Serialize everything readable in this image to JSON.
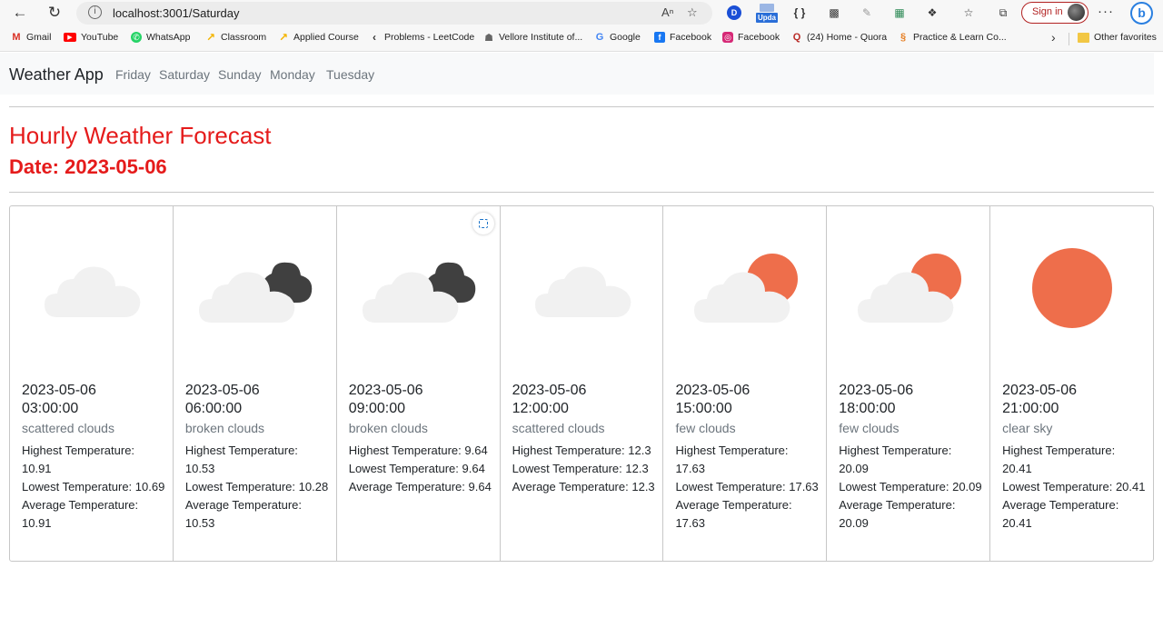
{
  "browser": {
    "url": "localhost:3001/Saturday",
    "ext_update_label": "Upda",
    "signin_label": "Sign in",
    "bookmarks": [
      {
        "label": "Gmail",
        "icon": "gmail-icon",
        "color": "#d93025",
        "glyph": "M"
      },
      {
        "label": "YouTube",
        "icon": "youtube-icon",
        "color": "#ff0000",
        "glyph": "▶"
      },
      {
        "label": "WhatsApp",
        "icon": "whatsapp-icon",
        "color": "#25d366",
        "glyph": "✆"
      },
      {
        "label": "Classroom",
        "icon": "classroom-icon",
        "color": "#f4b400",
        "glyph": "↗"
      },
      {
        "label": "Applied Course",
        "icon": "applied-course-icon",
        "color": "#f4b400",
        "glyph": "↗"
      },
      {
        "label": "Problems - LeetCode",
        "icon": "leetcode-icon",
        "color": "#333333",
        "glyph": "‹"
      },
      {
        "label": "Vellore Institute of...",
        "icon": "vit-icon",
        "color": "#666666",
        "glyph": "☗"
      },
      {
        "label": "Google",
        "icon": "google-icon",
        "color": "#4285f4",
        "glyph": "G"
      },
      {
        "label": "Facebook",
        "icon": "facebook-icon",
        "color": "#1877f2",
        "glyph": "f"
      },
      {
        "label": "Facebook",
        "icon": "instagram-icon",
        "color": "#d62976",
        "glyph": "◎"
      },
      {
        "label": "(24) Home - Quora",
        "icon": "quora-icon",
        "color": "#b92b27",
        "glyph": "Q"
      },
      {
        "label": "Practice & Learn Co...",
        "icon": "gfg-icon",
        "color": "#e67e22",
        "glyph": "§"
      }
    ],
    "other_favorites": "Other favorites"
  },
  "navbar": {
    "brand": "Weather App",
    "links": [
      "Friday",
      "Saturday",
      "Sunday",
      "Monday",
      "Tuesday"
    ]
  },
  "header": {
    "title": "Hourly Weather Forecast",
    "date": "Date: 2023-05-06"
  },
  "forecast": [
    {
      "date": "2023-05-06",
      "time": "03:00:00",
      "desc": "scattered clouds",
      "icon": "scattered-clouds-icon",
      "high_label": "Highest Temperature:",
      "high": "10.91",
      "low_label": "Lowest Temperature:",
      "low": "10.69",
      "avg_label": "Average Temperature:",
      "avg": "10.91"
    },
    {
      "date": "2023-05-06",
      "time": "06:00:00",
      "desc": "broken clouds",
      "icon": "broken-clouds-icon",
      "high_label": "Highest Temperature:",
      "high": "10.53",
      "low_label": "Lowest Temperature:",
      "low": "10.28",
      "avg_label": "Average Temperature:",
      "avg": "10.53"
    },
    {
      "date": "2023-05-06",
      "time": "09:00:00",
      "desc": "broken clouds",
      "icon": "broken-clouds-icon",
      "high_label": "Highest Temperature:",
      "high": "9.64",
      "low_label": "Lowest Temperature:",
      "low": "9.64",
      "avg_label": "Average Temperature:",
      "avg": "9.64"
    },
    {
      "date": "2023-05-06",
      "time": "12:00:00",
      "desc": "scattered clouds",
      "icon": "scattered-clouds-icon",
      "high_label": "Highest Temperature:",
      "high": "12.3",
      "low_label": "Lowest Temperature:",
      "low": "12.3",
      "avg_label": "Average Temperature:",
      "avg": "12.3"
    },
    {
      "date": "2023-05-06",
      "time": "15:00:00",
      "desc": "few clouds",
      "icon": "few-clouds-icon",
      "high_label": "Highest Temperature:",
      "high": "17.63",
      "low_label": "Lowest Temperature:",
      "low": "17.63",
      "avg_label": "Average Temperature:",
      "avg": "17.63"
    },
    {
      "date": "2023-05-06",
      "time": "18:00:00",
      "desc": "few clouds",
      "icon": "few-clouds-icon",
      "high_label": "Highest Temperature:",
      "high": "20.09",
      "low_label": "Lowest Temperature:",
      "low": "20.09",
      "avg_label": "Average Temperature:",
      "avg": "20.09"
    },
    {
      "date": "2023-05-06",
      "time": "21:00:00",
      "desc": "clear sky",
      "icon": "clear-sky-icon",
      "high_label": "Highest Temperature:",
      "high": "20.41",
      "low_label": "Lowest Temperature:",
      "low": "20.41",
      "avg_label": "Average Temperature:",
      "avg": "20.41"
    }
  ],
  "colors": {
    "heading": "#e51b1b",
    "sun": "#ee6e4b",
    "cloud_light": "#f1f1f1",
    "cloud_dark": "#404040"
  }
}
